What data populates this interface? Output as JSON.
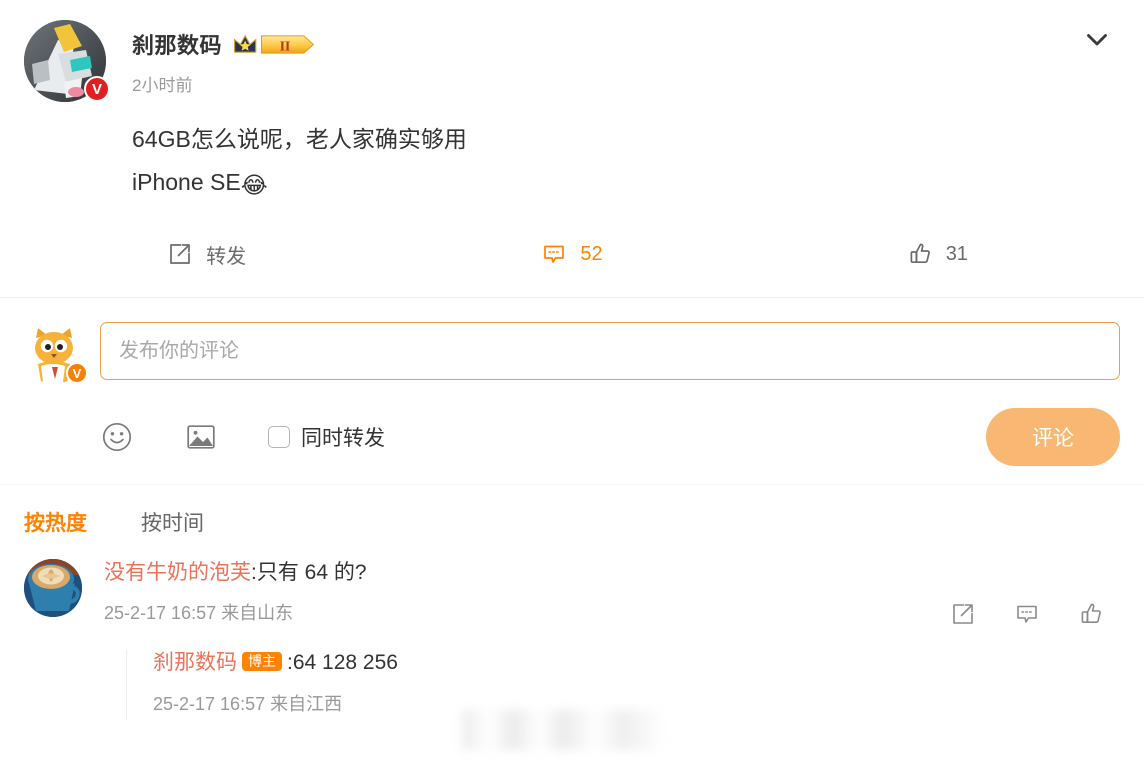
{
  "post": {
    "author": "刹那数码",
    "vip_badge_level": "II",
    "verified_badge": "V",
    "timestamp": "2小时前",
    "text_lines": [
      "64GB怎么说呢，老人家确实够用",
      "iPhone SE"
    ],
    "trailing_emoji": "😂",
    "collapse_icon": "chevron-down-icon"
  },
  "actions": {
    "repost_label": "转发",
    "repost_icon": "share-box-arrow-icon",
    "comment_count": "52",
    "comment_icon": "comment-bubble-icon",
    "like_count": "31",
    "like_icon": "thumbs-up-icon"
  },
  "composer": {
    "placeholder": "发布你的评论",
    "value": "",
    "emoji_icon": "smiley-face-icon",
    "image_icon": "picture-icon",
    "repost_checkbox_label": "同时转发",
    "repost_checkbox_checked": false,
    "submit_label": "评论",
    "submit_color": "#f8b772",
    "border_color": "#e8a34a",
    "user_verified_badge": "V"
  },
  "sort": {
    "tabs": [
      {
        "label": "按热度",
        "active": true
      },
      {
        "label": "按时间",
        "active": false
      }
    ],
    "active_color": "#ff8200"
  },
  "comments": [
    {
      "author": "没有牛奶的泡芙",
      "separator": ":",
      "text": "只有 64 的?",
      "date": "25-2-17 16:57",
      "location": "来自山东",
      "author_color": "#ec7259",
      "actions": [
        "share-box-arrow-icon",
        "comment-bubble-icon",
        "thumbs-up-icon"
      ],
      "reply": {
        "author": "刹那数码",
        "badge": "博主",
        "badge_color": "#ff8200",
        "separator": ":",
        "text": "64 128 256",
        "date": "25-2-17 16:57",
        "location": "来自江西"
      }
    }
  ]
}
